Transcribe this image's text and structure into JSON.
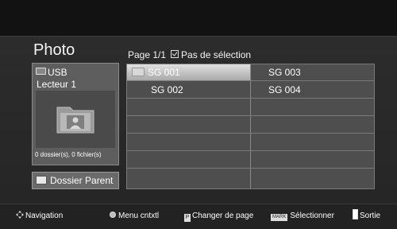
{
  "header": {
    "title": "Photo"
  },
  "source": {
    "device": "USB",
    "name": "Lecteur 1",
    "status": "0 dossier(s), 0 fichier(s)"
  },
  "parent_button": {
    "label": "Dossier Parent"
  },
  "page": {
    "indicator": "Page 1/1",
    "selection": "Pas de sélection"
  },
  "items": [
    {
      "label": "SG 001",
      "selected": true,
      "type": "folder"
    },
    {
      "label": "SG 002",
      "selected": false,
      "type": "folder"
    },
    {
      "label": "SG 003",
      "selected": false,
      "type": "folder"
    },
    {
      "label": "SG 004",
      "selected": false,
      "type": "folder"
    }
  ],
  "help": {
    "navigation": "Navigation",
    "menu": "Menu cntxtl",
    "page": "Changer de page",
    "page_key": "P",
    "mark": "Sélectionner",
    "mark_key": "MARK",
    "exit": "Sortie"
  },
  "colors": {
    "selected_row": "#c8c8c8",
    "panel": "#5e5e5e",
    "grid": "#4e4e4e"
  }
}
